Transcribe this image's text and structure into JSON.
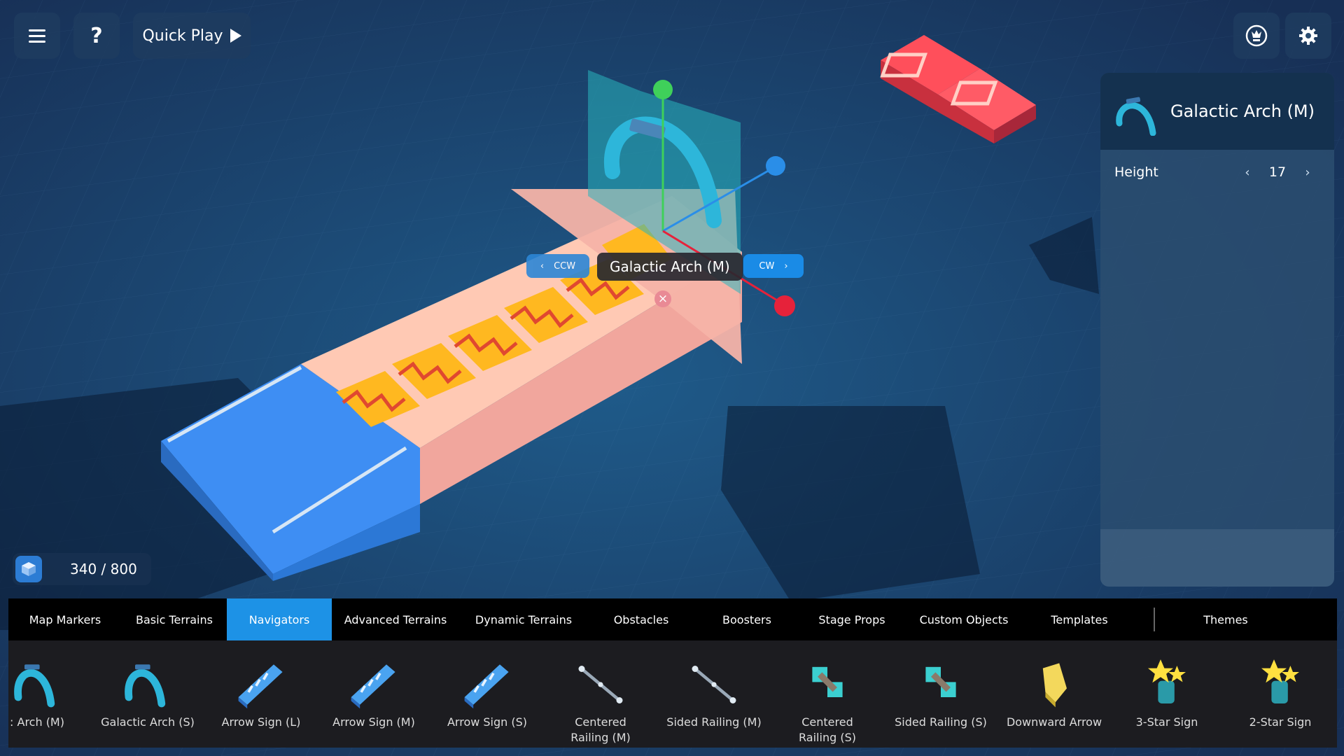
{
  "toolbar": {
    "help_label": "?",
    "quickplay_label": "Quick Play"
  },
  "icons": {
    "menu": "hamburger-icon",
    "trophy": "trophy-icon",
    "settings": "gear-icon",
    "play": "play-icon",
    "delete": "close-icon",
    "counter": "cube-icon"
  },
  "scene": {
    "object_label": "Galactic Arch (M)",
    "ccw_label": "CCW",
    "cw_label": "CW",
    "delete_symbol": "×"
  },
  "panel": {
    "title": "Galactic Arch (M)",
    "height_label": "Height",
    "height_value": "17",
    "prev_symbol": "‹",
    "next_symbol": "›"
  },
  "counter": {
    "text": "340 / 800"
  },
  "categories": {
    "tabs": [
      "Map Markers",
      "Basic Terrains",
      "Navigators",
      "Advanced Terrains",
      "Dynamic Terrains",
      "Obstacles",
      "Boosters",
      "Stage Props",
      "Custom Objects",
      "Templates"
    ],
    "active": "Navigators",
    "themes_label": "Themes"
  },
  "items": [
    {
      "name": ": Arch (M)",
      "icon": "arch-icon"
    },
    {
      "name": "Galactic Arch (S)",
      "icon": "arch-icon"
    },
    {
      "name": "Arrow Sign (L)",
      "icon": "arrow-sign-icon"
    },
    {
      "name": "Arrow Sign (M)",
      "icon": "arrow-sign-icon"
    },
    {
      "name": "Arrow Sign (S)",
      "icon": "arrow-sign-icon"
    },
    {
      "name": "Centered Railing (M)",
      "icon": "railing-icon"
    },
    {
      "name": "Sided Railing (M)",
      "icon": "railing-icon"
    },
    {
      "name": "Centered Railing (S)",
      "icon": "railing-icon"
    },
    {
      "name": "Sided Railing (S)",
      "icon": "railing-icon"
    },
    {
      "name": "Downward Arrow",
      "icon": "downward-arrow-icon"
    },
    {
      "name": "3-Star Sign",
      "icon": "star-sign-icon"
    },
    {
      "name": "2-Star Sign",
      "icon": "star-sign-icon"
    }
  ],
  "colors": {
    "accent": "#1d92e6",
    "background": "#1b3b63",
    "panel_header": "#14314f"
  }
}
